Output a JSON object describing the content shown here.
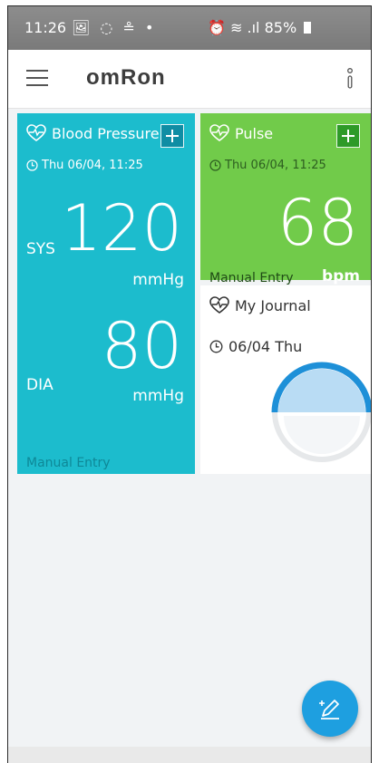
{
  "status_bar": {
    "time": "11:26",
    "left_icons": "🖼 ◌ ≗ •",
    "right_icons": "⏰ ≋ .ıl",
    "battery": "85%"
  },
  "app_bar": {
    "brand": "omRon"
  },
  "blood_pressure": {
    "title": "Blood Pressure",
    "timestamp": "Thu 06/04, 11:25",
    "sys_label": "SYS",
    "sys_value": "120",
    "sys_unit": "mmHg",
    "dia_label": "DIA",
    "dia_value": "80",
    "dia_unit": "mmHg",
    "entry_type": "Manual Entry",
    "color": "#1cbccd"
  },
  "pulse": {
    "title": "Pulse",
    "timestamp": "Thu 06/04, 11:25",
    "value": "68",
    "unit": "bpm",
    "entry_type": "Manual Entry",
    "color": "#71cb4a"
  },
  "journal": {
    "title": "My Journal",
    "date": "06/04 Thu"
  },
  "icons": [
    "heart-pulse-icon",
    "clock-icon",
    "plus-icon",
    "hamburger-icon",
    "kebab-icon",
    "edit-pen-icon"
  ]
}
